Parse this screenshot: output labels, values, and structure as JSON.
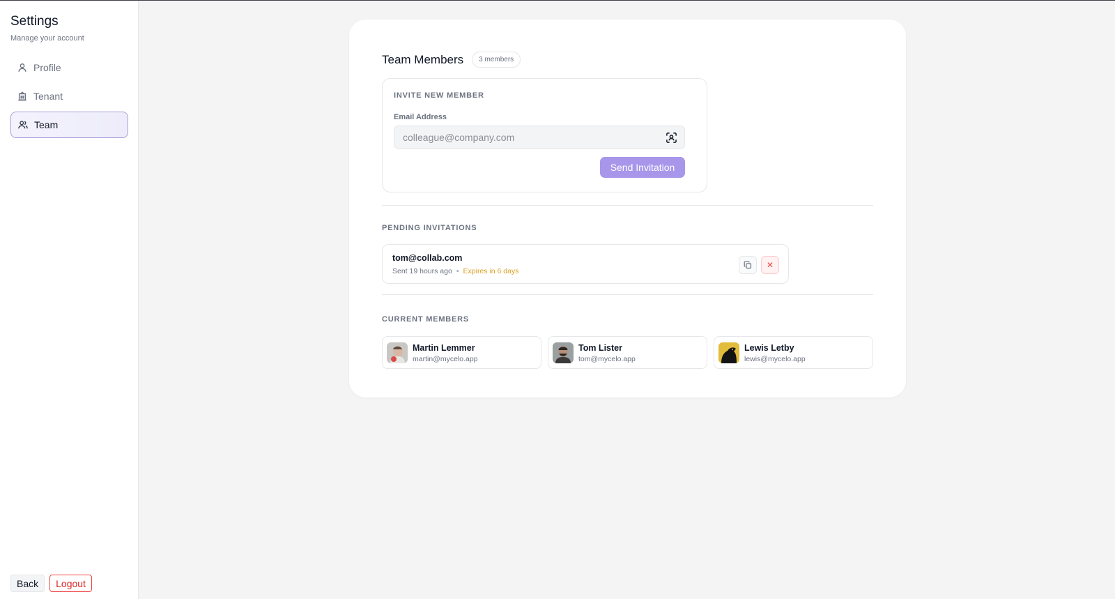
{
  "sidebar": {
    "title": "Settings",
    "subtitle": "Manage your account",
    "items": [
      {
        "label": "Profile",
        "icon": "user-icon",
        "active": false
      },
      {
        "label": "Tenant",
        "icon": "building-icon",
        "active": false
      },
      {
        "label": "Team",
        "icon": "users-icon",
        "active": true
      }
    ],
    "back_label": "Back",
    "logout_label": "Logout"
  },
  "team": {
    "title": "Team Members",
    "count_badge": "3 members"
  },
  "invite": {
    "section_title": "INVITE NEW MEMBER",
    "email_label": "Email Address",
    "email_value": "",
    "email_placeholder": "colleague@company.com",
    "send_label": "Send Invitation"
  },
  "pending": {
    "section_title": "PENDING INVITATIONS",
    "items": [
      {
        "email": "tom@collab.com",
        "sent": "Sent 19 hours ago",
        "separator": "•",
        "expires": "Expires in 6 days"
      }
    ],
    "cancel_glyph": "✕"
  },
  "members": {
    "section_title": "CURRENT MEMBERS",
    "items": [
      {
        "name": "Martin Lemmer",
        "email": "martin@mycelo.app"
      },
      {
        "name": "Tom Lister",
        "email": "tom@mycelo.app"
      },
      {
        "name": "Lewis Letby",
        "email": "lewis@mycelo.app"
      }
    ]
  },
  "colors": {
    "accent": "#a796ea",
    "active_border": "#a5a0d6",
    "warning": "#d9a020",
    "danger": "#ef4444"
  }
}
